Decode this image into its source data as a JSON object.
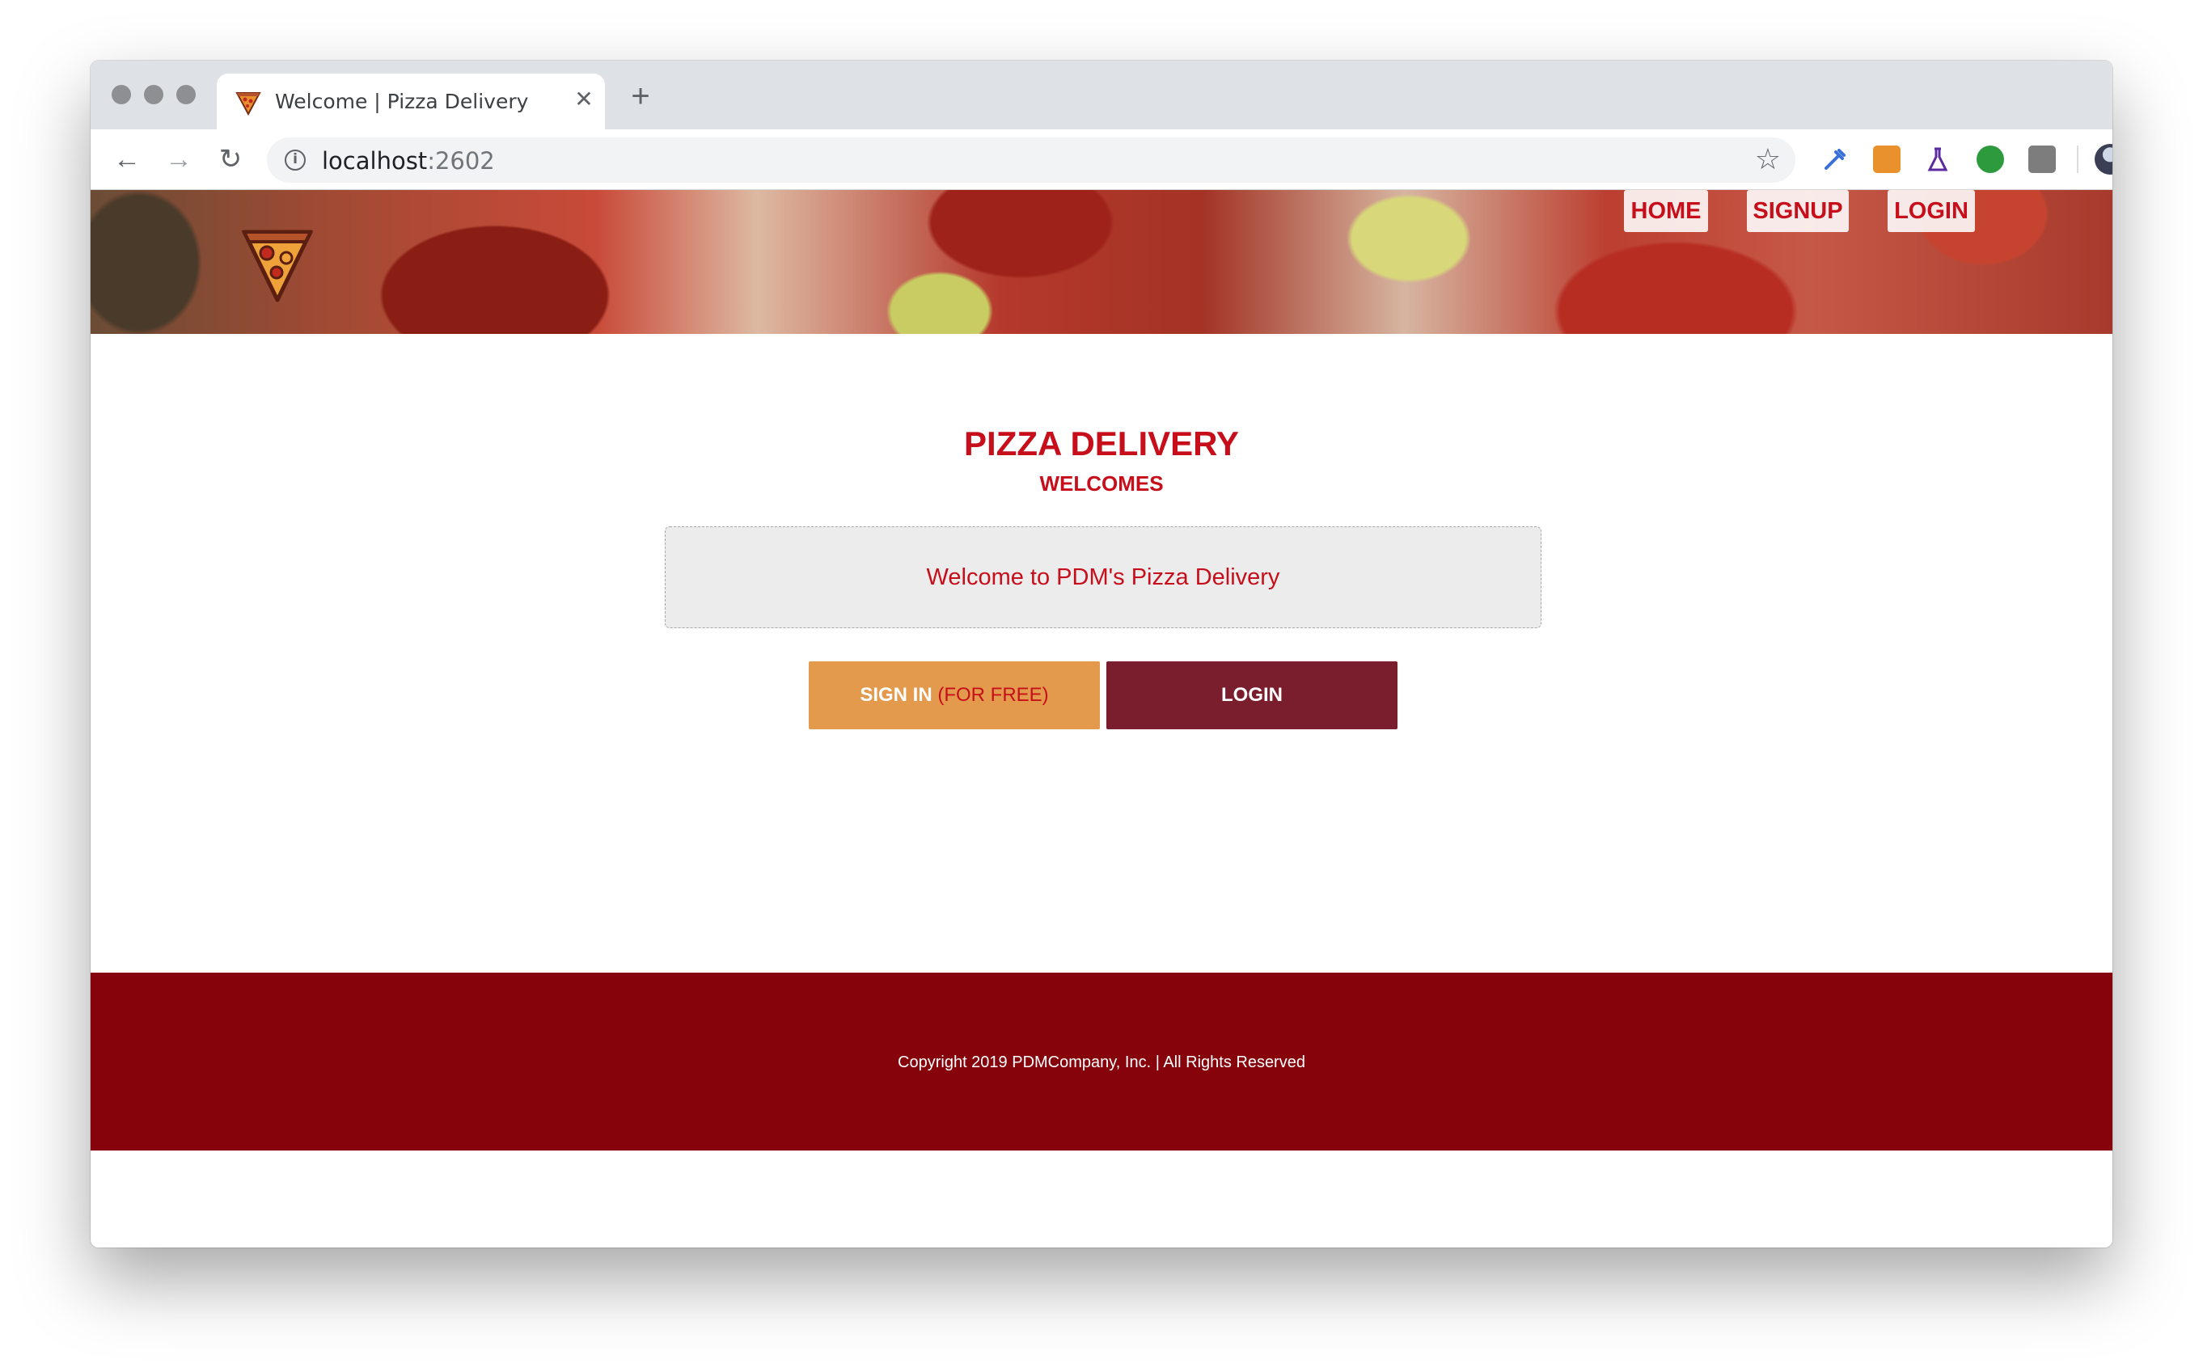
{
  "browser": {
    "tab_title": "Welcome | Pizza Delivery",
    "tab_close": "✕",
    "new_tab": "+",
    "url_host": "localhost",
    "url_port": ":2602",
    "back": "←",
    "forward": "→",
    "reload": "↻",
    "star": "☆",
    "menu": "⋮"
  },
  "header": {
    "nav": [
      {
        "label": "HOME"
      },
      {
        "label": "SIGNUP"
      },
      {
        "label": "LOGIN"
      }
    ]
  },
  "main": {
    "title": "PIZZA DELIVERY",
    "subtitle": "WELCOMES",
    "welcome_message": "Welcome to PDM's Pizza Delivery",
    "signin_label": "SIGN IN",
    "signin_suffix": "(FOR FREE)",
    "login_label": "LOGIN"
  },
  "footer": {
    "copyright": "Copyright 2019 PDMCompany, Inc. | All Rights Reserved"
  },
  "colors": {
    "brand_red": "#c60f1b",
    "footer_bg": "#86030b",
    "signin_bg": "#e39a4c",
    "login_bg": "#7a1e2e"
  }
}
